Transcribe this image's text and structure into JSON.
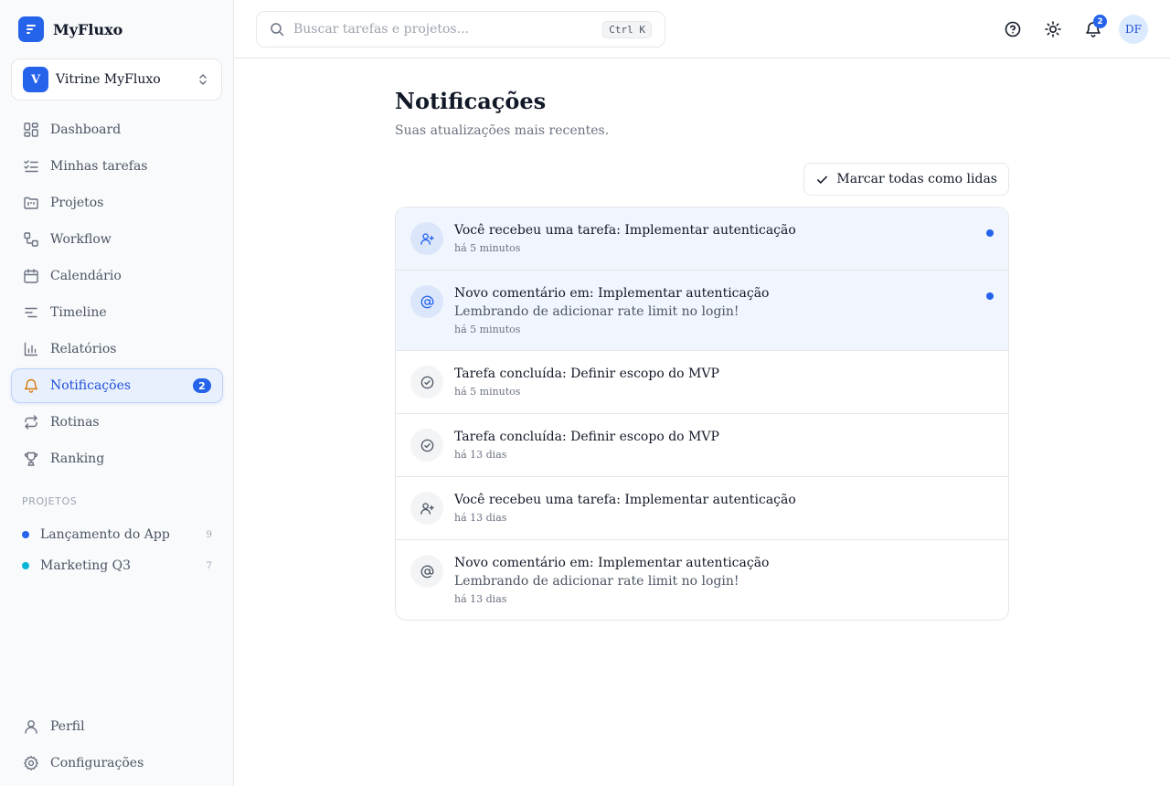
{
  "brand": {
    "name": "MyFluxo"
  },
  "workspace": {
    "initial": "V",
    "name": "Vitrine MyFluxo"
  },
  "nav": [
    {
      "id": "dashboard",
      "label": "Dashboard",
      "icon": "dashboard-icon"
    },
    {
      "id": "minhas-tarefas",
      "label": "Minhas tarefas",
      "icon": "checklist-icon"
    },
    {
      "id": "projetos",
      "label": "Projetos",
      "icon": "folder-kanban-icon"
    },
    {
      "id": "workflow",
      "label": "Workflow",
      "icon": "workflow-icon"
    },
    {
      "id": "calendario",
      "label": "Calendário",
      "icon": "calendar-icon"
    },
    {
      "id": "timeline",
      "label": "Timeline",
      "icon": "timeline-icon"
    },
    {
      "id": "relatorios",
      "label": "Relatórios",
      "icon": "bar-chart-icon"
    },
    {
      "id": "notificacoes",
      "label": "Notificações",
      "icon": "bell-icon",
      "badge": "2",
      "active": true
    },
    {
      "id": "rotinas",
      "label": "Rotinas",
      "icon": "repeat-icon"
    },
    {
      "id": "ranking",
      "label": "Ranking",
      "icon": "trophy-icon"
    }
  ],
  "projects": {
    "heading": "PROJETOS",
    "items": [
      {
        "name": "Lançamento do App",
        "count": "9",
        "color": "#2563eb"
      },
      {
        "name": "Marketing Q3",
        "count": "7",
        "color": "#06b6d4"
      }
    ]
  },
  "bottom_nav": [
    {
      "id": "perfil",
      "label": "Perfil",
      "icon": "user-icon"
    },
    {
      "id": "configuracoes",
      "label": "Configurações",
      "icon": "gear-icon"
    }
  ],
  "topbar": {
    "search_placeholder": "Buscar tarefas e projetos...",
    "shortcut": "Ctrl K",
    "bell_badge": "2",
    "avatar_initials": "DF"
  },
  "page": {
    "title": "Notificações",
    "subtitle": "Suas atualizações mais recentes.",
    "mark_all_label": "Marcar todas como lidas"
  },
  "notifications": [
    {
      "type": "assigned",
      "icon": "user-plus-icon",
      "title": "Você recebeu uma tarefa: Implementar autenticação",
      "detail": "",
      "time": "há 5 minutos",
      "unread": true
    },
    {
      "type": "comment",
      "icon": "at-sign-icon",
      "title": "Novo comentário em: Implementar autenticação",
      "detail": "Lembrando de adicionar rate limit no login!",
      "time": "há 5 minutos",
      "unread": true
    },
    {
      "type": "completed",
      "icon": "check-circle-icon",
      "title": "Tarefa concluída: Definir escopo do MVP",
      "detail": "",
      "time": "há 5 minutos",
      "unread": false
    },
    {
      "type": "completed",
      "icon": "check-circle-icon",
      "title": "Tarefa concluída: Definir escopo do MVP",
      "detail": "",
      "time": "há 13 dias",
      "unread": false
    },
    {
      "type": "assigned",
      "icon": "user-plus-icon",
      "title": "Você recebeu uma tarefa: Implementar autenticação",
      "detail": "",
      "time": "há 13 dias",
      "unread": false
    },
    {
      "type": "comment",
      "icon": "at-sign-icon",
      "title": "Novo comentário em: Implementar autenticação",
      "detail": "Lembrando de adicionar rate limit no login!",
      "time": "há 13 dias",
      "unread": false
    }
  ],
  "colors": {
    "accent": "#2563eb",
    "active_bg": "#e8f0fe",
    "unread_bg": "#f1f5fd"
  }
}
